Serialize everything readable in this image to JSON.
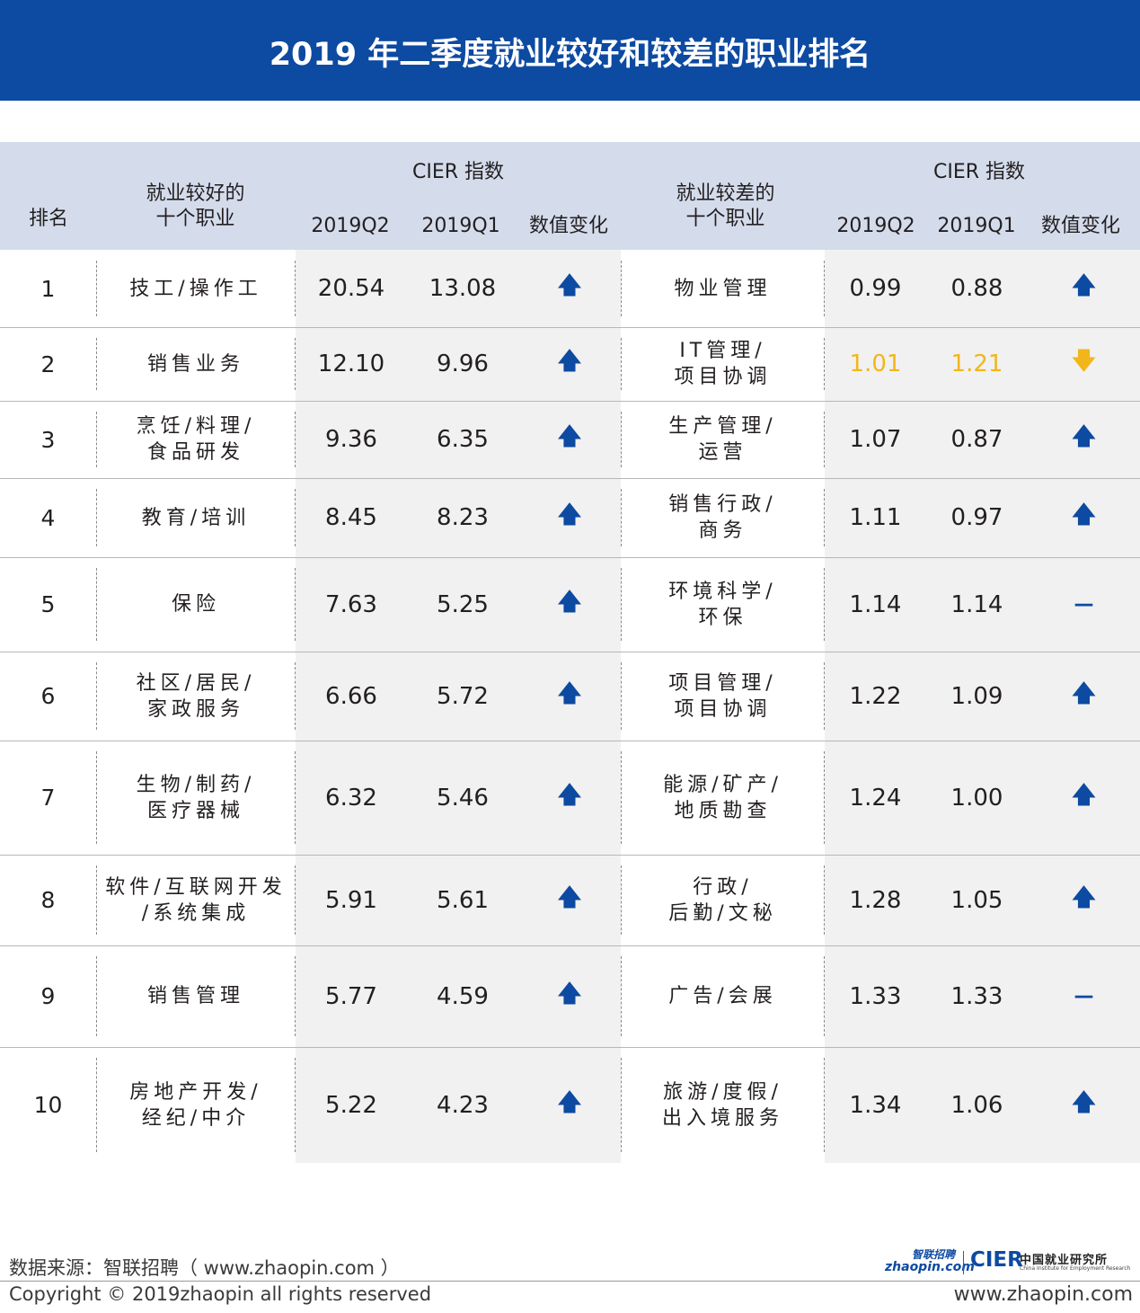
{
  "title": "2019 年二季度就业较好和较差的职业排名",
  "header": {
    "rank": "排名",
    "good_jobs": "就业较好的\n十个职业",
    "bad_jobs": "就业较差的\n十个职业",
    "cier_index": "CIER 指数",
    "q2": "2019Q2",
    "q1": "2019Q1",
    "change": "数值变化"
  },
  "rows": [
    {
      "rank": "1",
      "good": "技工/操作工",
      "good_q2": "20.54",
      "good_q1": "13.08",
      "good_change": "up",
      "bad": "物业管理",
      "bad_q2": "0.99",
      "bad_q1": "0.88",
      "bad_change": "up"
    },
    {
      "rank": "2",
      "good": "销售业务",
      "good_q2": "12.10",
      "good_q1": "9.96",
      "good_change": "up",
      "bad": "IT管理/\n项目协调",
      "bad_q2": "1.01",
      "bad_q1": "1.21",
      "bad_change": "down"
    },
    {
      "rank": "3",
      "good": "烹饪/料理/\n食品研发",
      "good_q2": "9.36",
      "good_q1": "6.35",
      "good_change": "up",
      "bad": "生产管理/\n运营",
      "bad_q2": "1.07",
      "bad_q1": "0.87",
      "bad_change": "up"
    },
    {
      "rank": "4",
      "good": "教育/培训",
      "good_q2": "8.45",
      "good_q1": "8.23",
      "good_change": "up",
      "bad": "销售行政/\n商务",
      "bad_q2": "1.11",
      "bad_q1": "0.97",
      "bad_change": "up"
    },
    {
      "rank": "5",
      "good": "保险",
      "good_q2": "7.63",
      "good_q1": "5.25",
      "good_change": "up",
      "bad": "环境科学/\n环保",
      "bad_q2": "1.14",
      "bad_q1": "1.14",
      "bad_change": "flat"
    },
    {
      "rank": "6",
      "good": "社区/居民/\n家政服务",
      "good_q2": "6.66",
      "good_q1": "5.72",
      "good_change": "up",
      "bad": "项目管理/\n项目协调",
      "bad_q2": "1.22",
      "bad_q1": "1.09",
      "bad_change": "up"
    },
    {
      "rank": "7",
      "good": "生物/制药/\n医疗器械",
      "good_q2": "6.32",
      "good_q1": "5.46",
      "good_change": "up",
      "bad": "能源/矿产/\n地质勘查",
      "bad_q2": "1.24",
      "bad_q1": "1.00",
      "bad_change": "up"
    },
    {
      "rank": "8",
      "good": "软件/互联网开发\n/系统集成",
      "good_q2": "5.91",
      "good_q1": "5.61",
      "good_change": "up",
      "bad": "行政/\n后勤/文秘",
      "bad_q2": "1.28",
      "bad_q1": "1.05",
      "bad_change": "up"
    },
    {
      "rank": "9",
      "good": "销售管理",
      "good_q2": "5.77",
      "good_q1": "4.59",
      "good_change": "up",
      "bad": "广告/会展",
      "bad_q2": "1.33",
      "bad_q1": "1.33",
      "bad_change": "flat"
    },
    {
      "rank": "10",
      "good": "房地产开发/\n经纪/中介",
      "good_q2": "5.22",
      "good_q1": "4.23",
      "good_change": "up",
      "bad": "旅游/度假/\n出入境服务",
      "bad_q2": "1.34",
      "bad_q1": "1.06",
      "bad_change": "up"
    }
  ],
  "symbols": {
    "up": "🡅",
    "down": "🡇",
    "flat": "—"
  },
  "colors": {
    "brand_blue": "#0d4aa1",
    "header_bg": "#d4dcec",
    "band_bg": "#f1f1f1",
    "decrease_yellow": "#f2b61b"
  },
  "footer": {
    "source": "数据来源：智联招聘（ www.zhaopin.com ）",
    "copyright": "Copyright © 2019zhaopin all rights reserved",
    "website": "www.zhaopin.com",
    "logo_zhaopin_cn": "智联招聘",
    "logo_zhaopin_en": "zhaopin.com",
    "logo_cier": "CIER",
    "logo_cier_cn": "中国就业研究所",
    "logo_cier_en": "China Institute for Employment Research"
  }
}
